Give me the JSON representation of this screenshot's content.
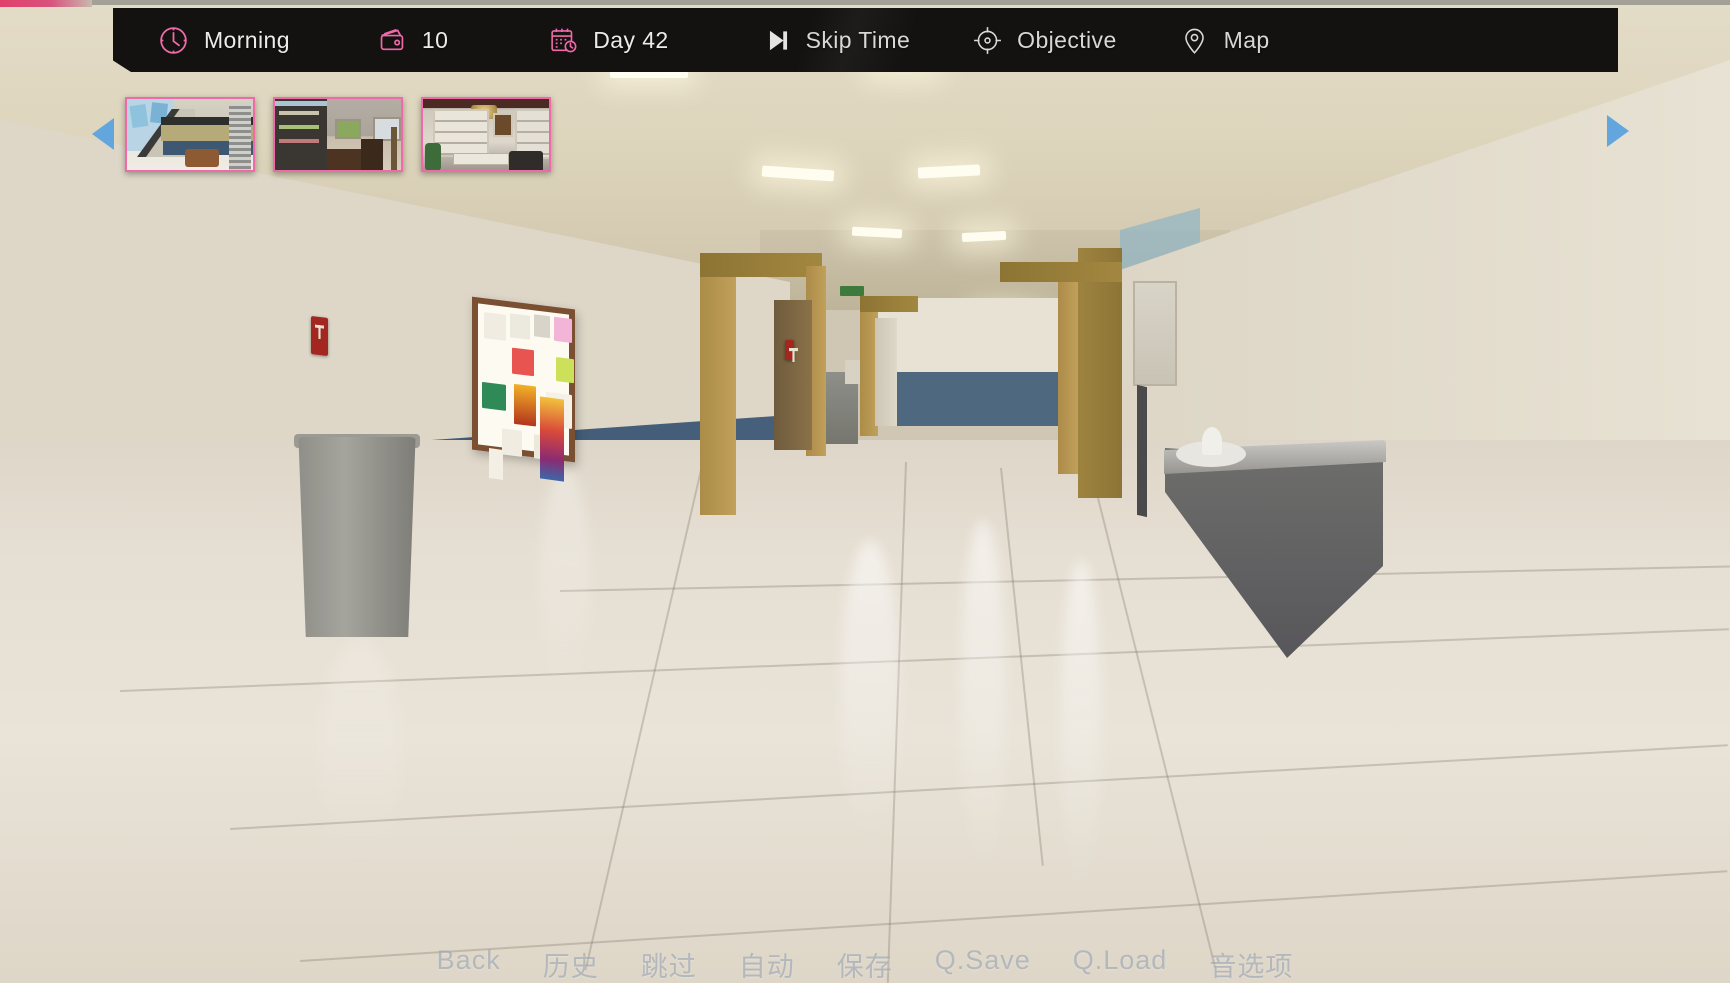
{
  "hud": {
    "items": [
      {
        "icon": "clock-icon",
        "label": "Morning",
        "type": "time-of-day"
      },
      {
        "icon": "wallet-icon",
        "label": "10",
        "type": "money"
      },
      {
        "icon": "calendar-icon",
        "label": "Day 42",
        "type": "day-counter"
      },
      {
        "icon": "skip-icon",
        "label": "Skip Time",
        "type": "action"
      },
      {
        "icon": "target-icon",
        "label": "Objective",
        "type": "action"
      },
      {
        "icon": "map-pin-icon",
        "label": "Map",
        "type": "action"
      }
    ],
    "accent_color": "#f06aa8",
    "bar_color": "#141211",
    "text_color": "#eceaea"
  },
  "locations": {
    "prev_arrow": "left-arrow",
    "next_arrow": "right-arrow",
    "selected_index": 0,
    "border_color": "#f069a8",
    "thumbnails": [
      {
        "name": "school-atrium-thumbnail"
      },
      {
        "name": "dining-room-thumbnail"
      },
      {
        "name": "study-office-thumbnail"
      }
    ]
  },
  "bottom_menu": {
    "items": [
      "Back",
      "历史",
      "跳过",
      "自动",
      "保存",
      "Q.Save",
      "Q.Load",
      "音选项"
    ],
    "text_color": "#96a2b0"
  },
  "scene": {
    "name": "school-hallway",
    "wall_upper_color": "#ded7c8",
    "wall_lower_color": "#3e5873",
    "floor_color": "#e6dfd3",
    "pillar_color": "#ab8c48"
  }
}
